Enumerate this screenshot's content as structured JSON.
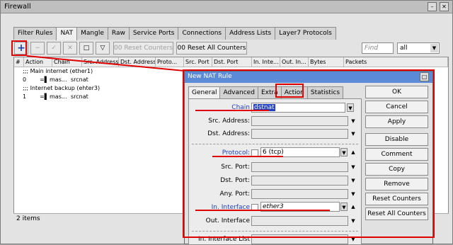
{
  "window": {
    "title": "Firewall",
    "min": "–",
    "close": "✕"
  },
  "tabs": [
    "Filter Rules",
    "NAT",
    "Mangle",
    "Raw",
    "Service Ports",
    "Connections",
    "Address Lists",
    "Layer7 Protocols"
  ],
  "toolbar": {
    "add": "+",
    "remove": "−",
    "enable": "✓",
    "disable": "✕",
    "comment": "□",
    "filter": "▽",
    "reset_counters": "00 Reset Counters",
    "reset_all_counters": "00 Reset All Counters",
    "find_placeholder": "Find",
    "filter_select": "all"
  },
  "columns": [
    "#",
    "Action",
    "Chain",
    "Src. Address",
    "Dst. Address",
    "Proto...",
    "Src. Port",
    "Dst. Port",
    "In. Inte...",
    "Out. In...",
    "Bytes",
    "Packets"
  ],
  "rows": [
    {
      "type": "comment",
      "text": ";;; Main internet (ether1)"
    },
    {
      "num": "0",
      "action": "mas...",
      "chain": "srcnat"
    },
    {
      "type": "comment",
      "text": ";;; Internet backup (ehter3)"
    },
    {
      "num": "1",
      "action": "mas...",
      "chain": "srcnat"
    }
  ],
  "status": "2 items",
  "dialog": {
    "title": "New NAT Rule",
    "tabs": [
      "General",
      "Advanced",
      "Extra",
      "Action",
      "Statistics"
    ],
    "fields": {
      "chain_label": "Chain",
      "chain_value": "dstnat",
      "src_address_label": "Src. Address:",
      "dst_address_label": "Dst. Address:",
      "protocol_label": "Protocol:",
      "protocol_value": "6 (tcp)",
      "src_port_label": "Src. Port:",
      "dst_port_label": "Dst. Port:",
      "any_port_label": "Any. Port:",
      "in_interface_label": "In. Interface",
      "in_interface_value": "ether3",
      "out_interface_label": "Out. Interface",
      "in_interface_list_label": "In. Interface List"
    },
    "buttons": [
      "OK",
      "Cancel",
      "Apply",
      "Disable",
      "Comment",
      "Copy",
      "Remove",
      "Reset Counters",
      "Reset All Counters"
    ]
  },
  "colors": {
    "highlight": "#e00000",
    "dialog_title": "#5a8ad8",
    "link_label": "#1f3fc0"
  }
}
